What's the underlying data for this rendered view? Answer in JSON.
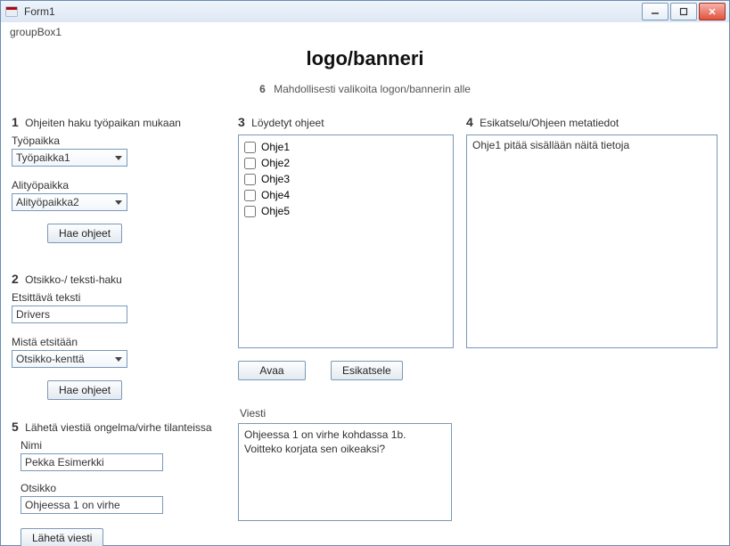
{
  "window": {
    "title": "Form1"
  },
  "groupbox_label": "groupBox1",
  "banner": "logo/banneri",
  "subbanner": {
    "num": "6",
    "text": "Mahdollisesti valikoita logon/bannerin alle"
  },
  "section1": {
    "num": "1",
    "title": "Ohjeiten haku työpaikan mukaan",
    "workplace_label": "Työpaikka",
    "workplace_value": "Työpaikka1",
    "subworkplace_label": "Alityöpaikka",
    "subworkplace_value": "Alityöpaikka2",
    "fetch_button": "Hae ohjeet"
  },
  "section2": {
    "num": "2",
    "title": "Otsikko-/ teksti-haku",
    "searchtext_label": "Etsittävä teksti",
    "searchtext_value": "Drivers",
    "searchfrom_label": "Mistä etsitään",
    "searchfrom_value": "Otsikko-kenttä",
    "fetch_button": "Hae ohjeet"
  },
  "section5": {
    "num": "5",
    "title": "Lähetä viestiä ongelma/virhe tilanteissa",
    "name_label": "Nimi",
    "name_value": "Pekka Esimerkki",
    "subject_label": "Otsikko",
    "subject_value": "Ohjeessa 1 on virhe",
    "send_button": "Lähetä viesti"
  },
  "section3": {
    "num": "3",
    "title": "Löydetyt ohjeet",
    "items": [
      "Ohje1",
      "Ohje2",
      "Ohje3",
      "Ohje4",
      "Ohje5"
    ],
    "open_button": "Avaa",
    "preview_button": "Esikatsele",
    "message_label": "Viesti",
    "message_value": "Ohjeessa 1 on virhe kohdassa 1b. Voitteko korjata sen oikeaksi?"
  },
  "section4": {
    "num": "4",
    "title": "Esikatselu/Ohjeen metatiedot",
    "preview_text": "Ohje1 pitää sisällään näitä tietoja"
  }
}
